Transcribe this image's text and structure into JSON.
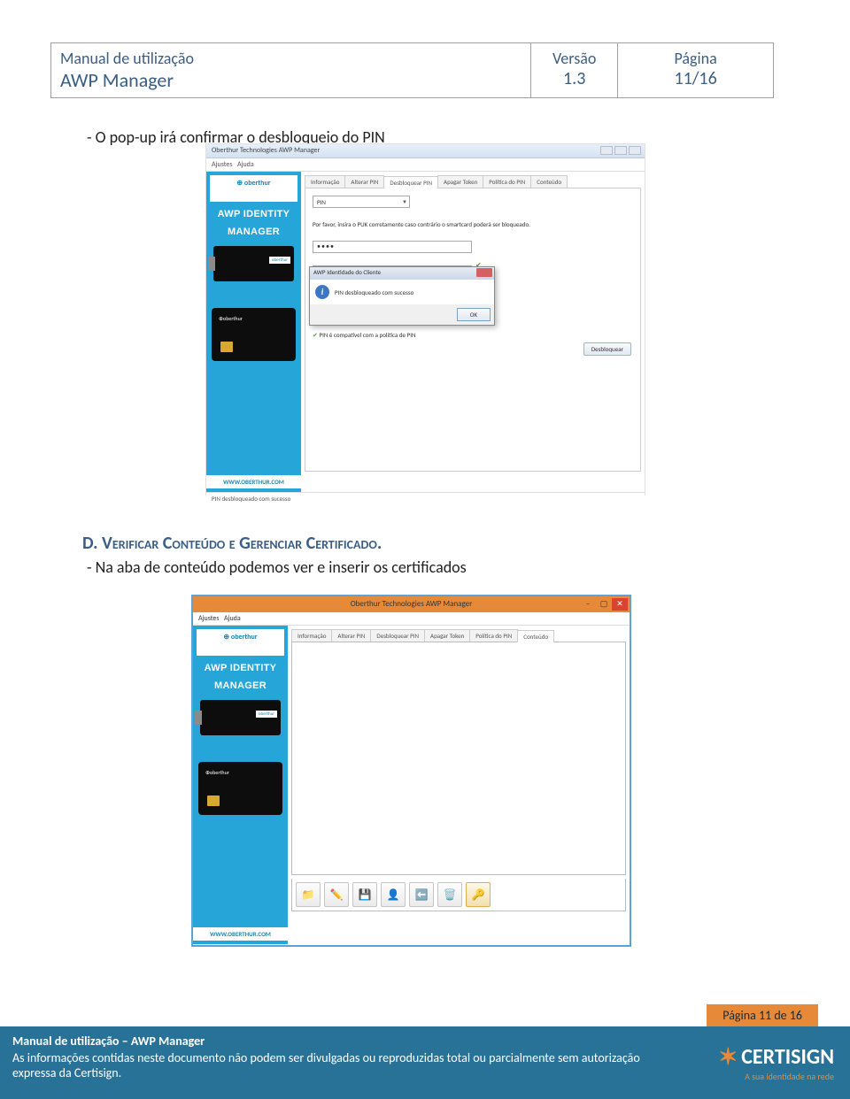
{
  "header": {
    "manual_label": "Manual de utilização",
    "title": "AWP Manager",
    "version_label": "Versão",
    "version_value": "1.3",
    "page_label": "Página",
    "page_value": "11/16"
  },
  "text1": "- O pop-up irá confirmar o desbloqueio do PIN",
  "shot1": {
    "window_title": "Oberthur Technologies AWP Manager",
    "menu_ajustes": "Ajustes",
    "menu_ajuda": "Ajuda",
    "sidebar_logo": "⊕ oberthur",
    "sidebar_line1": "AWP IDENTITY",
    "sidebar_line2": "MANAGER",
    "sidebar_url": "WWW.OBERTHUR.COM",
    "tabs": [
      "Informação",
      "Alterar PIN",
      "Desbloquear PIN",
      "Apagar Token",
      "Política do PIN",
      "Conteúdo"
    ],
    "active_tab_index": 2,
    "pin_select": "PIN",
    "instruction": "Por favor, insira o PUK corretamente caso contrário o smartcard poderá ser bloqueado.",
    "field1": "••••",
    "field2": "••••",
    "pin_compat": "PIN é compatível com a política de PIN",
    "desbloquear": "Desbloquear",
    "dialog_title": "AWP Identidade do Cliente",
    "dialog_msg": "PIN desbloqueado com sucesso",
    "dialog_ok": "OK",
    "status": "PIN desbloqueado com sucesso"
  },
  "section_d_letter": "D.",
  "section_d_title": "Verificar Conteúdo e Gerenciar Certificado.",
  "text2": "- Na aba de conteúdo podemos ver e inserir os certificados",
  "shot2": {
    "window_title": "Oberthur Technologies AWP Manager",
    "menu_ajustes": "Ajustes",
    "menu_ajuda": "Ajuda",
    "sidebar_logo": "⊕ oberthur",
    "sidebar_line1": "AWP IDENTITY",
    "sidebar_line2": "MANAGER",
    "sidebar_url": "WWW.OBERTHUR.COM",
    "tabs": [
      "Informação",
      "Alterar PIN",
      "Desbloquear PIN",
      "Apagar Token",
      "Política do PIN",
      "Conteúdo"
    ],
    "active_tab_index": 5,
    "toolbar_icons": [
      "📁",
      "✏️",
      "💾",
      "👤",
      "⬅️",
      "🗑️",
      "🔑"
    ]
  },
  "footer": {
    "page_tag": "Página 11 de 16",
    "title": "Manual de utilização – AWP Manager",
    "text": "As informações contidas neste documento não podem ser divulgadas ou reproduzidas total ou parcialmente sem autorização expressa da Certisign.",
    "logo_main": "CERTISIGN",
    "logo_sub": "A sua identidade na rede"
  }
}
